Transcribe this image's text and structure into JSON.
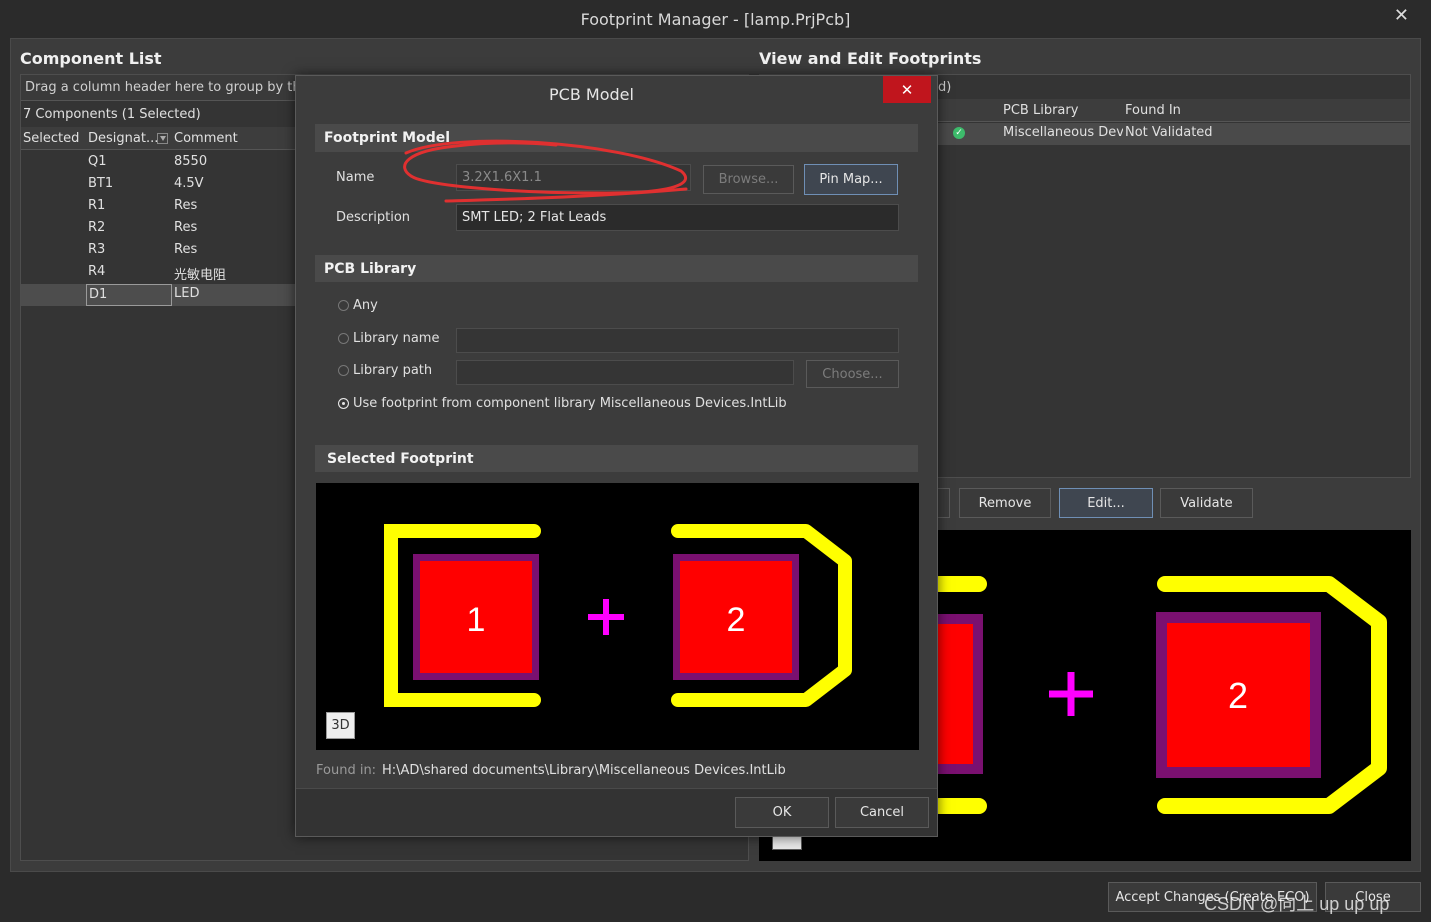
{
  "window": {
    "title": "Footprint Manager - [lamp.PrjPcb]",
    "close": "✕"
  },
  "component_list": {
    "title": "Component List",
    "group_hint": "Drag a column header here to group by that",
    "count": "7 Components (1 Selected)",
    "columns": [
      "Selected",
      "Designat...",
      "Comment"
    ],
    "rows": [
      {
        "designator": "Q1",
        "comment": "8550"
      },
      {
        "designator": "BT1",
        "comment": "4.5V"
      },
      {
        "designator": "R1",
        "comment": "Res"
      },
      {
        "designator": "R2",
        "comment": "Res"
      },
      {
        "designator": "R3",
        "comment": "Res"
      },
      {
        "designator": "R4",
        "comment": "光敏电阻"
      },
      {
        "designator": "D1",
        "comment": "LED"
      }
    ]
  },
  "view_edit": {
    "title": "View and Edit Footprints",
    "group_hint": "d)",
    "columns": [
      "PCB Library",
      "Found In"
    ],
    "row": {
      "pcb_library": "Miscellaneous Devic",
      "found_in": "Not Validated"
    },
    "buttons": {
      "remove": "Remove",
      "edit": "Edit...",
      "validate": "Validate"
    },
    "preview": {
      "pad2": "2"
    }
  },
  "bottom_buttons": {
    "accept": "Accept Changes (Create ECO)",
    "close": "Close"
  },
  "watermark": "CSDN @向上 up up up",
  "modal": {
    "title": "PCB Model",
    "close": "✕",
    "footprint_model": {
      "header": "Footprint Model",
      "name_label": "Name",
      "name_value": "3.2X1.6X1.1",
      "browse": "Browse...",
      "pin_map": "Pin Map...",
      "description_label": "Description",
      "description_value": "SMT LED; 2 Flat Leads"
    },
    "pcb_library": {
      "header": "PCB Library",
      "any": "Any",
      "library_name": "Library name",
      "library_path": "Library path",
      "choose": "Choose...",
      "use_component_lib": "Use footprint from component library Miscellaneous Devices.IntLib",
      "selected_option": "use_component_lib"
    },
    "selected_footprint": {
      "header": "Selected Footprint",
      "pad1": "1",
      "pad2": "2",
      "btn_3d": "3D",
      "found_in_label": "Found in:",
      "found_in_path": "H:\\AD\\shared documents\\Library\\Miscellaneous Devices.IntLib"
    },
    "ok": "OK",
    "cancel": "Cancel"
  },
  "colors": {
    "silkscreen": "#ffff00",
    "pad": "#ff0000",
    "pad_border": "#7a1070",
    "origin": "#ff00ff",
    "annotation": "#e03030",
    "close_bg": "#c0151d"
  }
}
